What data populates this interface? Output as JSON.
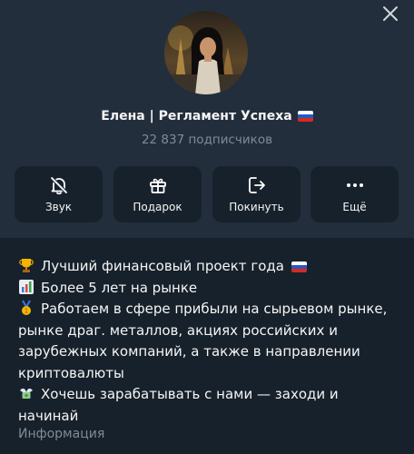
{
  "channel": {
    "name": "Елена | Регламент Успеха",
    "subscribers": "22 837 подписчиков"
  },
  "actions": [
    {
      "label": "Звук",
      "icon": "bell-off-icon"
    },
    {
      "label": "Подарок",
      "icon": "gift-icon"
    },
    {
      "label": "Покинуть",
      "icon": "leave-icon"
    },
    {
      "label": "Ещё",
      "icon": "more-icon"
    }
  ],
  "description": {
    "line1": "Лучший финансовый проект года",
    "line2": "Более 5 лет на рынке",
    "line3a": "Работаем в сфере прибыли на сырьевом рынке,",
    "line3b": "рынке драг. металлов, акциях российских и",
    "line3c": "зарубежных компаний, а также в направлении",
    "line3d": "криптовалюты",
    "line4a": "Хочешь зарабатывать с нами — заходи и",
    "line4b": "начинай"
  },
  "info_label": "Информация",
  "colors": {
    "background": "#17212b",
    "header": "#232e3c",
    "secondary_text": "#7f8b98"
  }
}
